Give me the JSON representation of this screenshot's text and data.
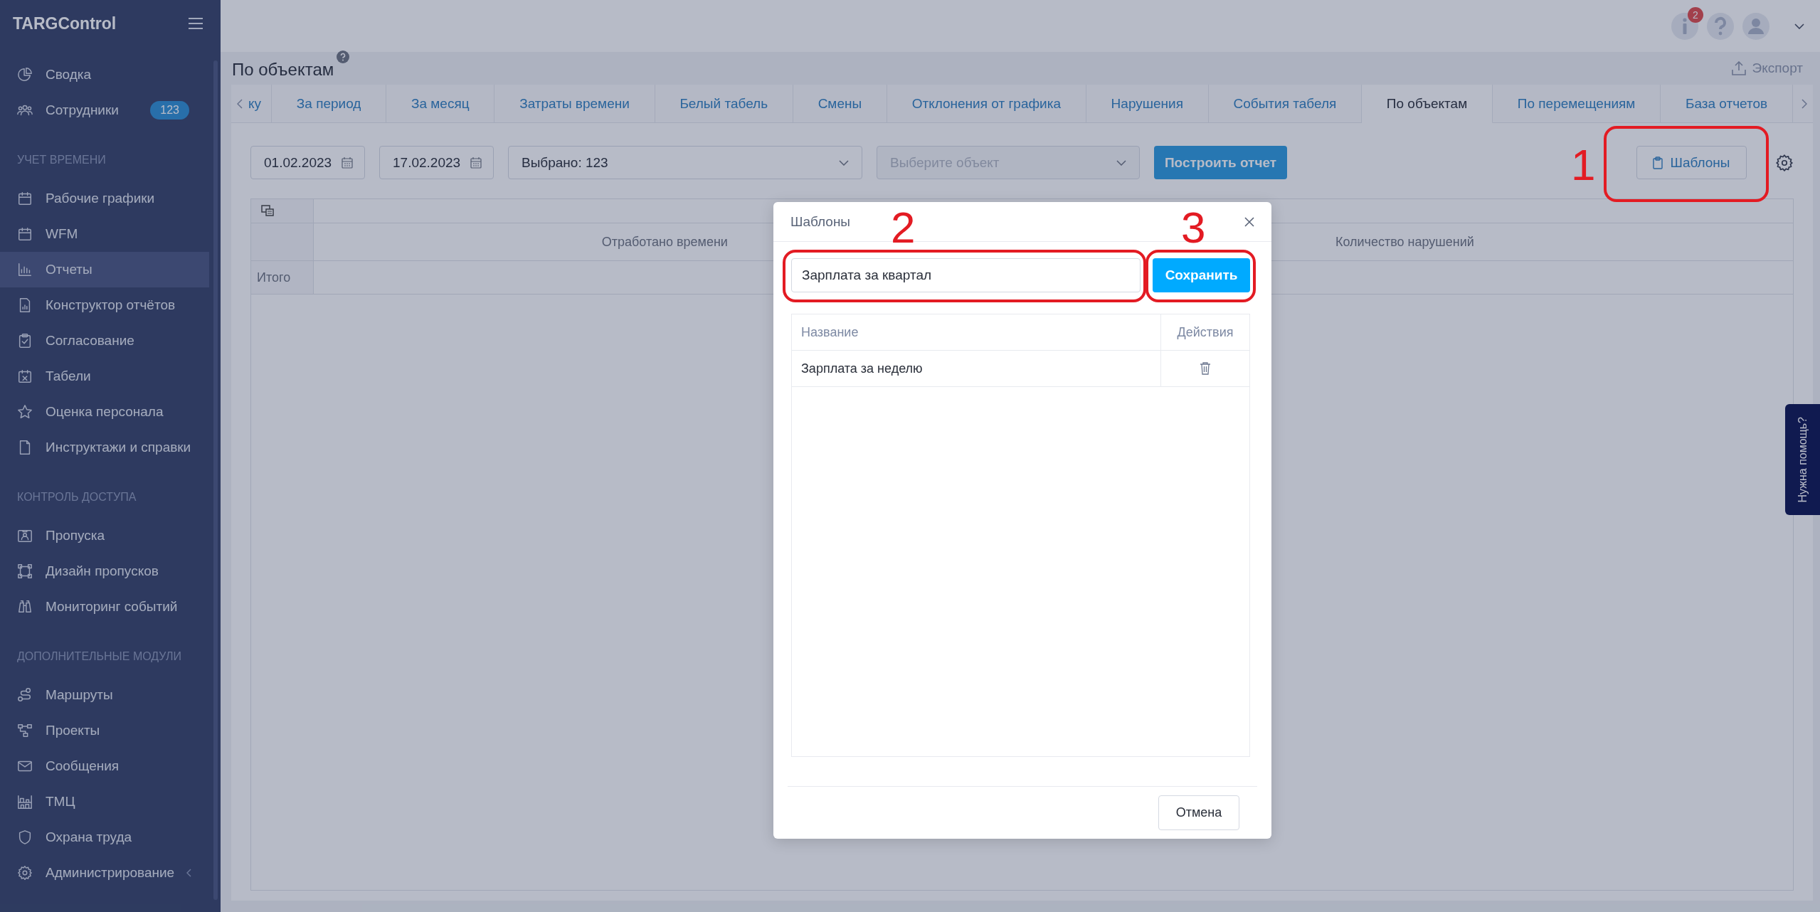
{
  "sidebar": {
    "logo": "TARGControl",
    "groups": [
      {
        "items": [
          {
            "label": "Сводка",
            "selected": false
          },
          {
            "label": "Сотрудники",
            "selected": false,
            "badge": "123"
          }
        ]
      },
      {
        "heading": "УЧЕТ ВРЕМЕНИ",
        "items": [
          {
            "label": "Рабочие графики",
            "selected": false
          },
          {
            "label": "WFM",
            "selected": false
          },
          {
            "label": "Отчеты",
            "selected": true
          },
          {
            "label": "Конструктор отчётов",
            "selected": false
          },
          {
            "label": "Согласование",
            "selected": false
          },
          {
            "label": "Табели",
            "selected": false
          },
          {
            "label": "Оценка персонала",
            "selected": false
          },
          {
            "label": "Инструктажи и справки",
            "selected": false
          }
        ]
      },
      {
        "heading": "КОНТРОЛЬ ДОСТУПА",
        "items": [
          {
            "label": "Пропуска",
            "selected": false
          },
          {
            "label": "Дизайн пропусков",
            "selected": false
          },
          {
            "label": "Мониторинг событий",
            "selected": false
          }
        ]
      },
      {
        "heading": "ДОПОЛНИТЕЛЬНЫЕ МОДУЛИ",
        "items": [
          {
            "label": "Маршруты",
            "selected": false
          },
          {
            "label": "Проекты",
            "selected": false
          },
          {
            "label": "Сообщения",
            "selected": false
          },
          {
            "label": "ТМЦ",
            "selected": false
          },
          {
            "label": "Охрана труда",
            "selected": false
          }
        ]
      },
      {
        "items": [
          {
            "label": "Администрирование",
            "selected": false
          }
        ]
      }
    ]
  },
  "header": {
    "notification_count": "2"
  },
  "page": {
    "title": "По объектам",
    "export": "Экспорт"
  },
  "tabs": [
    {
      "label": "ку",
      "selected": false
    },
    {
      "label": "За период",
      "selected": false
    },
    {
      "label": "За месяц",
      "selected": false
    },
    {
      "label": "Затраты времени",
      "selected": false
    },
    {
      "label": "Белый табель",
      "selected": false
    },
    {
      "label": "Смены",
      "selected": false
    },
    {
      "label": "Отклонения от графика",
      "selected": false
    },
    {
      "label": "Нарушения",
      "selected": false
    },
    {
      "label": "События табеля",
      "selected": false
    },
    {
      "label": "По объектам",
      "selected": true
    },
    {
      "label": "По перемещениям",
      "selected": false
    },
    {
      "label": "База отчетов",
      "selected": false
    }
  ],
  "filters": {
    "date_from": "01.02.2023",
    "date_to": "17.02.2023",
    "employees": "Выбрано: 123",
    "object_select": {
      "placeholder": "Выберите объект",
      "disabled": true
    },
    "build_button": "Построить отчет",
    "templates_button": "Шаблоны"
  },
  "report_table": {
    "columns": [
      "Отработано времени",
      "Количество нарушений"
    ],
    "total_label": "Итого"
  },
  "modal": {
    "title": "Шаблоны",
    "name_value": "Зарплата за квартал",
    "save_button": "Сохранить",
    "columns": [
      "Название",
      "Действия"
    ],
    "rows": [
      {
        "name": "Зарплата за неделю"
      }
    ],
    "cancel_button": "Отмена"
  },
  "help_tab": "Нужна помощь?",
  "annotations": [
    {
      "number": "1"
    },
    {
      "number": "2"
    },
    {
      "number": "3"
    }
  ]
}
